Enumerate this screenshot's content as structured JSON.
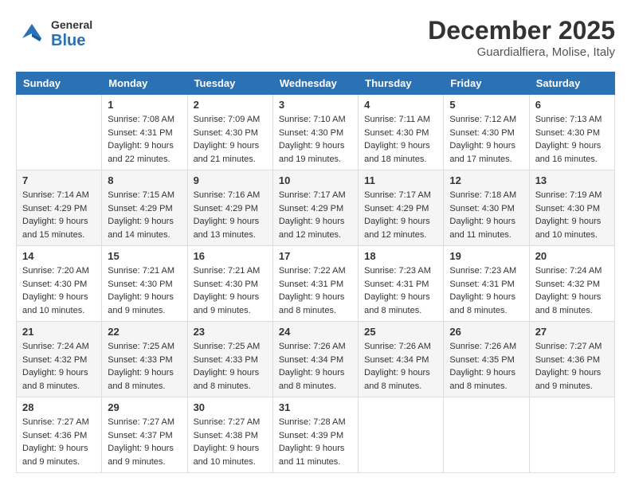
{
  "header": {
    "logo": {
      "line1": "General",
      "line2": "Blue"
    },
    "title": "December 2025",
    "location": "Guardialfiera, Molise, Italy"
  },
  "calendar": {
    "weekdays": [
      "Sunday",
      "Monday",
      "Tuesday",
      "Wednesday",
      "Thursday",
      "Friday",
      "Saturday"
    ],
    "weeks": [
      [
        null,
        {
          "day": "1",
          "sunrise": "7:08 AM",
          "sunset": "4:31 PM",
          "daylight": "9 hours and 22 minutes."
        },
        {
          "day": "2",
          "sunrise": "7:09 AM",
          "sunset": "4:30 PM",
          "daylight": "9 hours and 21 minutes."
        },
        {
          "day": "3",
          "sunrise": "7:10 AM",
          "sunset": "4:30 PM",
          "daylight": "9 hours and 19 minutes."
        },
        {
          "day": "4",
          "sunrise": "7:11 AM",
          "sunset": "4:30 PM",
          "daylight": "9 hours and 18 minutes."
        },
        {
          "day": "5",
          "sunrise": "7:12 AM",
          "sunset": "4:30 PM",
          "daylight": "9 hours and 17 minutes."
        },
        {
          "day": "6",
          "sunrise": "7:13 AM",
          "sunset": "4:30 PM",
          "daylight": "9 hours and 16 minutes."
        }
      ],
      [
        {
          "day": "7",
          "sunrise": "7:14 AM",
          "sunset": "4:29 PM",
          "daylight": "9 hours and 15 minutes."
        },
        {
          "day": "8",
          "sunrise": "7:15 AM",
          "sunset": "4:29 PM",
          "daylight": "9 hours and 14 minutes."
        },
        {
          "day": "9",
          "sunrise": "7:16 AM",
          "sunset": "4:29 PM",
          "daylight": "9 hours and 13 minutes."
        },
        {
          "day": "10",
          "sunrise": "7:17 AM",
          "sunset": "4:29 PM",
          "daylight": "9 hours and 12 minutes."
        },
        {
          "day": "11",
          "sunrise": "7:17 AM",
          "sunset": "4:29 PM",
          "daylight": "9 hours and 12 minutes."
        },
        {
          "day": "12",
          "sunrise": "7:18 AM",
          "sunset": "4:30 PM",
          "daylight": "9 hours and 11 minutes."
        },
        {
          "day": "13",
          "sunrise": "7:19 AM",
          "sunset": "4:30 PM",
          "daylight": "9 hours and 10 minutes."
        }
      ],
      [
        {
          "day": "14",
          "sunrise": "7:20 AM",
          "sunset": "4:30 PM",
          "daylight": "9 hours and 10 minutes."
        },
        {
          "day": "15",
          "sunrise": "7:21 AM",
          "sunset": "4:30 PM",
          "daylight": "9 hours and 9 minutes."
        },
        {
          "day": "16",
          "sunrise": "7:21 AM",
          "sunset": "4:30 PM",
          "daylight": "9 hours and 9 minutes."
        },
        {
          "day": "17",
          "sunrise": "7:22 AM",
          "sunset": "4:31 PM",
          "daylight": "9 hours and 8 minutes."
        },
        {
          "day": "18",
          "sunrise": "7:23 AM",
          "sunset": "4:31 PM",
          "daylight": "9 hours and 8 minutes."
        },
        {
          "day": "19",
          "sunrise": "7:23 AM",
          "sunset": "4:31 PM",
          "daylight": "9 hours and 8 minutes."
        },
        {
          "day": "20",
          "sunrise": "7:24 AM",
          "sunset": "4:32 PM",
          "daylight": "9 hours and 8 minutes."
        }
      ],
      [
        {
          "day": "21",
          "sunrise": "7:24 AM",
          "sunset": "4:32 PM",
          "daylight": "9 hours and 8 minutes."
        },
        {
          "day": "22",
          "sunrise": "7:25 AM",
          "sunset": "4:33 PM",
          "daylight": "9 hours and 8 minutes."
        },
        {
          "day": "23",
          "sunrise": "7:25 AM",
          "sunset": "4:33 PM",
          "daylight": "9 hours and 8 minutes."
        },
        {
          "day": "24",
          "sunrise": "7:26 AM",
          "sunset": "4:34 PM",
          "daylight": "9 hours and 8 minutes."
        },
        {
          "day": "25",
          "sunrise": "7:26 AM",
          "sunset": "4:34 PM",
          "daylight": "9 hours and 8 minutes."
        },
        {
          "day": "26",
          "sunrise": "7:26 AM",
          "sunset": "4:35 PM",
          "daylight": "9 hours and 8 minutes."
        },
        {
          "day": "27",
          "sunrise": "7:27 AM",
          "sunset": "4:36 PM",
          "daylight": "9 hours and 9 minutes."
        }
      ],
      [
        {
          "day": "28",
          "sunrise": "7:27 AM",
          "sunset": "4:36 PM",
          "daylight": "9 hours and 9 minutes."
        },
        {
          "day": "29",
          "sunrise": "7:27 AM",
          "sunset": "4:37 PM",
          "daylight": "9 hours and 9 minutes."
        },
        {
          "day": "30",
          "sunrise": "7:27 AM",
          "sunset": "4:38 PM",
          "daylight": "9 hours and 10 minutes."
        },
        {
          "day": "31",
          "sunrise": "7:28 AM",
          "sunset": "4:39 PM",
          "daylight": "9 hours and 11 minutes."
        },
        null,
        null,
        null
      ]
    ]
  }
}
